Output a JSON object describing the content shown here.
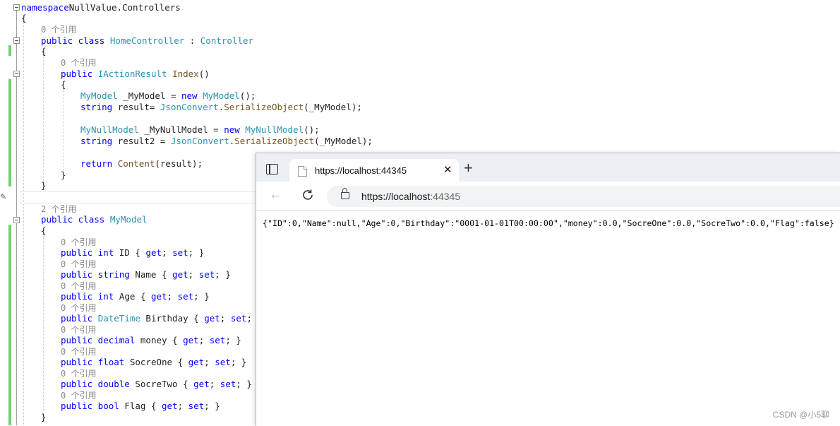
{
  "editor": {
    "lines": [
      [
        [
          "kw",
          "namespace"
        ],
        [
          "",
          "NullValue.Controllers"
        ]
      ],
      [
        [
          "",
          "{"
        ]
      ],
      [
        [
          "ref",
          "0 个引用"
        ]
      ],
      [
        [
          "kw",
          "public class "
        ],
        [
          "ty",
          "HomeController"
        ],
        [
          "",
          " : "
        ],
        [
          "ty",
          "Controller"
        ]
      ],
      [
        [
          "",
          "{"
        ]
      ],
      [
        [
          "ref",
          "0 个引用"
        ]
      ],
      [
        [
          "kw",
          "public "
        ],
        [
          "ty",
          "IActionResult"
        ],
        [
          "",
          " "
        ],
        [
          "mt",
          "Index"
        ],
        [
          "",
          "()"
        ]
      ],
      [
        [
          "",
          "{"
        ]
      ],
      [
        [
          "ty",
          "MyModel"
        ],
        [
          "",
          " _MyModel = "
        ],
        [
          "kw",
          "new "
        ],
        [
          "ty",
          "MyModel"
        ],
        [
          "",
          "();"
        ]
      ],
      [
        [
          "kw",
          "string "
        ],
        [
          "",
          "result= "
        ],
        [
          "ty",
          "JsonConvert"
        ],
        [
          "",
          "."
        ],
        [
          "mt",
          "SerializeObject"
        ],
        [
          "",
          "(_MyModel);"
        ]
      ],
      [
        [
          "ty",
          "MyNullModel"
        ],
        [
          "",
          " _MyNullModel = "
        ],
        [
          "kw",
          "new "
        ],
        [
          "ty",
          "MyNullModel"
        ],
        [
          "",
          "();"
        ]
      ],
      [
        [
          "kw",
          "string "
        ],
        [
          "",
          "result2 = "
        ],
        [
          "ty",
          "JsonConvert"
        ],
        [
          "",
          "."
        ],
        [
          "mt",
          "SerializeObject"
        ],
        [
          "",
          "(_MyModel);"
        ]
      ],
      [
        [
          "kw",
          "return "
        ],
        [
          "mt",
          "Content"
        ],
        [
          "",
          "(result);"
        ]
      ],
      [
        [
          "",
          "}"
        ]
      ],
      [
        [
          "",
          "}"
        ]
      ],
      [
        [
          "ref",
          "2 个引用"
        ]
      ],
      [
        [
          "kw",
          "public class "
        ],
        [
          "ty",
          "MyModel"
        ]
      ],
      [
        [
          "",
          "{"
        ]
      ],
      [
        [
          "ref",
          "0 个引用"
        ]
      ],
      [
        [
          "kw",
          "public int "
        ],
        [
          "",
          "ID { "
        ],
        [
          "kw",
          "get"
        ],
        [
          "",
          "; "
        ],
        [
          "kw",
          "set"
        ],
        [
          "",
          "; }"
        ]
      ],
      [
        [
          "ref",
          "0 个引用"
        ]
      ],
      [
        [
          "kw",
          "public string "
        ],
        [
          "",
          "Name { "
        ],
        [
          "kw",
          "get"
        ],
        [
          "",
          "; "
        ],
        [
          "kw",
          "set"
        ],
        [
          "",
          "; }"
        ]
      ],
      [
        [
          "ref",
          "0 个引用"
        ]
      ],
      [
        [
          "kw",
          "public int "
        ],
        [
          "",
          "Age { "
        ],
        [
          "kw",
          "get"
        ],
        [
          "",
          "; "
        ],
        [
          "kw",
          "set"
        ],
        [
          "",
          "; }"
        ]
      ],
      [
        [
          "ref",
          "0 个引用"
        ]
      ],
      [
        [
          "kw",
          "public "
        ],
        [
          "ty",
          "DateTime"
        ],
        [
          "",
          " Birthday { "
        ],
        [
          "kw",
          "get"
        ],
        [
          "",
          "; "
        ],
        [
          "kw",
          "set"
        ],
        [
          "",
          "; }"
        ]
      ],
      [
        [
          "ref",
          "0 个引用"
        ]
      ],
      [
        [
          "kw",
          "public decimal "
        ],
        [
          "",
          "money { "
        ],
        [
          "kw",
          "get"
        ],
        [
          "",
          "; "
        ],
        [
          "kw",
          "set"
        ],
        [
          "",
          "; }"
        ]
      ],
      [
        [
          "ref",
          "0 个引用"
        ]
      ],
      [
        [
          "kw",
          "public float "
        ],
        [
          "",
          "SocreOne { "
        ],
        [
          "kw",
          "get"
        ],
        [
          "",
          "; "
        ],
        [
          "kw",
          "set"
        ],
        [
          "",
          "; }"
        ]
      ],
      [
        [
          "ref",
          "0 个引用"
        ]
      ],
      [
        [
          "kw",
          "public double "
        ],
        [
          "",
          "SocreTwo { "
        ],
        [
          "kw",
          "get"
        ],
        [
          "",
          "; "
        ],
        [
          "kw",
          "set"
        ],
        [
          "",
          "; }"
        ]
      ],
      [
        [
          "ref",
          "0 个引用"
        ]
      ],
      [
        [
          "kw",
          "public bool "
        ],
        [
          "",
          "Flag { "
        ],
        [
          "kw",
          "get"
        ],
        [
          "",
          "; "
        ],
        [
          "kw",
          "set"
        ],
        [
          "",
          "; }"
        ]
      ],
      [
        [
          "",
          "}"
        ]
      ]
    ]
  },
  "browser": {
    "tab_title": "https://localhost:44345",
    "url_scheme": "https://",
    "url_host": "localhost",
    "url_port": ":44345",
    "page_text": "{\"ID\":0,\"Name\":null,\"Age\":0,\"Birthday\":\"0001-01-01T00:00:00\",\"money\":0.0,\"SocreOne\":0.0,\"SocreTwo\":0.0,\"Flag\":false}",
    "icons": [
      "tab-actions-icon",
      "page-favicon-icon",
      "close-icon",
      "plus-icon",
      "back-arrow-icon",
      "refresh-icon",
      "lock-icon"
    ]
  },
  "watermark": "CSDN @小5聊",
  "colors": {
    "keyword": "#0000ff",
    "type": "#2b91af",
    "method": "#74531f",
    "reference": "#8a8a8a",
    "change_bar": "#6fd36f"
  }
}
